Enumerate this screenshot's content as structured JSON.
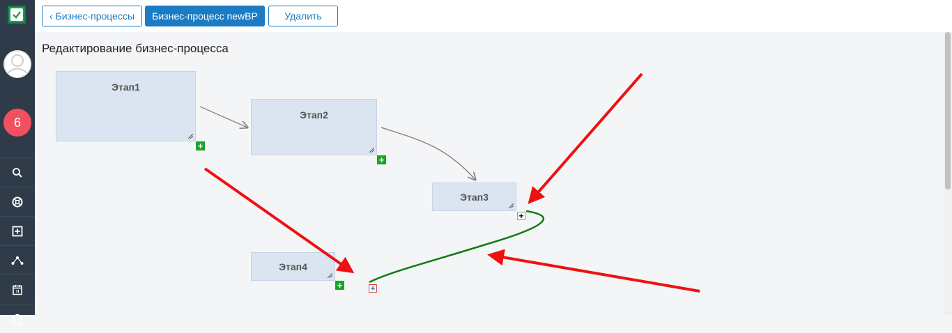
{
  "header": {
    "back_button": "‹ Бизнес-процессы",
    "current_button": "Бизнес-процесс newBP",
    "delete_button": "Удалить"
  },
  "page": {
    "title": "Редактирование бизнес-процесса"
  },
  "sidebar": {
    "badge_count": "6",
    "items": [
      {
        "icon": "search-icon"
      },
      {
        "icon": "lifebuoy-icon"
      },
      {
        "icon": "plus-square-icon"
      },
      {
        "icon": "share-nodes-icon"
      },
      {
        "icon": "calendar-icon"
      },
      {
        "icon": "clipboard-icon"
      }
    ]
  },
  "stages": [
    {
      "label": "Этап1"
    },
    {
      "label": "Этап2"
    },
    {
      "label": "Этап3"
    },
    {
      "label": "Этап4"
    }
  ],
  "colors": {
    "sidebar": "#2f3b48",
    "primary": "#1b7cc4",
    "stage_fill": "#dbe5f1",
    "add_button": "#18a428",
    "new_link": "#127a12",
    "annotation": "#ee1111"
  }
}
